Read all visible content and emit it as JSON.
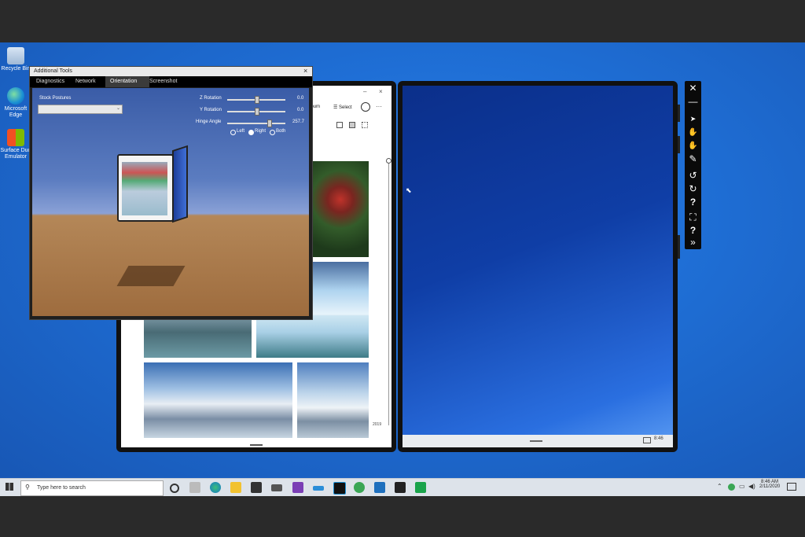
{
  "desktop": {
    "icons": [
      {
        "label": "Recycle Bin"
      },
      {
        "label": "Microsoft Edge"
      },
      {
        "label": "Surface Duo Emulator"
      }
    ]
  },
  "tools_window": {
    "title": "Additional Tools",
    "close_glyph": "×",
    "tabs": [
      "Diagnostics",
      "Network",
      "Orientation",
      "Screenshot"
    ],
    "active_tab": "Orientation",
    "stock_postures_label": "Stock Postures",
    "stock_postures_value": "",
    "z_rotation_label": "Z Rotation",
    "z_rotation_value": "0.0",
    "y_rotation_label": "Y Rotation",
    "y_rotation_value": "0.0",
    "hinge_angle_label": "Hinge Angle",
    "hinge_angle_value": "257.7",
    "radio_options": [
      "Left",
      "Right",
      "Both"
    ],
    "radio_selected": "Right"
  },
  "photos_app": {
    "partial_toolbar_text": "lbum",
    "select_label": "Select",
    "more_glyph": "···",
    "minimize_glyph": "–",
    "close_glyph": "×",
    "year_label": "2019"
  },
  "right_screen": {
    "status_time": "8:46"
  },
  "floating_toolbar": {
    "items": [
      {
        "icon": "close-icon",
        "glyph": "✕"
      },
      {
        "icon": "minimize-icon",
        "glyph": "—"
      },
      {
        "icon": "pointer-icon",
        "glyph": "➤"
      },
      {
        "icon": "hand-icon",
        "glyph": "✋"
      },
      {
        "icon": "multi-touch-icon",
        "glyph": "✋"
      },
      {
        "icon": "pen-icon",
        "glyph": "✎"
      },
      {
        "icon": "rotate-left-icon",
        "glyph": "↺"
      },
      {
        "icon": "rotate-right-icon",
        "glyph": "↻"
      },
      {
        "icon": "help-icon",
        "glyph": "?"
      },
      {
        "icon": "screenshot-icon",
        "glyph": "⛶"
      },
      {
        "icon": "help-icon-2",
        "glyph": "?"
      },
      {
        "icon": "expand-icon",
        "glyph": "»"
      }
    ]
  },
  "taskbar": {
    "search_placeholder": "Type here to search",
    "clock_time": "8:46 AM",
    "clock_date": "2/11/2020"
  },
  "colors": {
    "desktop_blue": "#1f6fd6",
    "taskbar_bg": "#dde3ea",
    "tools_bg": "#1f1f1f"
  }
}
